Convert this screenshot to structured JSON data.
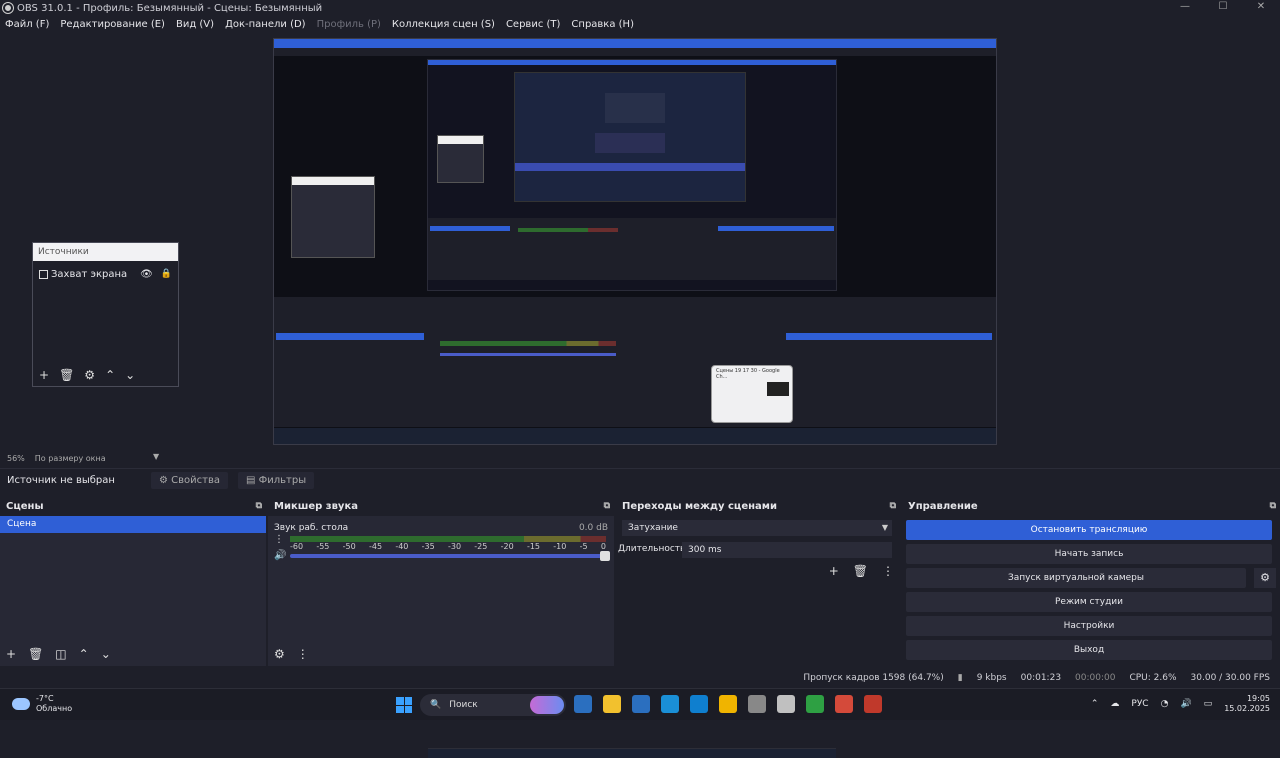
{
  "window": {
    "title": "OBS 31.0.1 - Профиль: Безымянный - Сцены: Безымянный",
    "controls": [
      "—",
      "☐",
      "✕"
    ]
  },
  "menu": [
    {
      "label": "Файл (F)",
      "disabled": false
    },
    {
      "label": "Редактирование (E)",
      "disabled": false
    },
    {
      "label": "Вид (V)",
      "disabled": false
    },
    {
      "label": "Док-панели (D)",
      "disabled": false
    },
    {
      "label": "Профиль (P)",
      "disabled": true
    },
    {
      "label": "Коллекция сцен (S)",
      "disabled": false
    },
    {
      "label": "Сервис (T)",
      "disabled": false
    },
    {
      "label": "Справка (H)",
      "disabled": false
    }
  ],
  "floating_sources": {
    "title": "Источники",
    "item": "Захват экрана"
  },
  "zoom": {
    "percent": "56%",
    "mode": "По размеру окна"
  },
  "context_bar": {
    "label": "Источник не выбран",
    "properties": "Свойства",
    "filters": "Фильтры"
  },
  "scenes": {
    "title": "Сцены",
    "items": [
      "Сцена"
    ]
  },
  "mixer": {
    "title": "Микшер звука",
    "track_name": "Звук раб. стола",
    "level": "0.0 dB",
    "ticks": [
      "-60",
      "-55",
      "-50",
      "-45",
      "-40",
      "-35",
      "-30",
      "-25",
      "-20",
      "-15",
      "-10",
      "-5",
      "0"
    ],
    "volume": 1.0
  },
  "transitions": {
    "title": "Переходы между сценами",
    "selected": "Затухание",
    "duration_label": "Длительность",
    "duration": "300 ms"
  },
  "controls": {
    "title": "Управление",
    "stop_stream": "Остановить трансляцию",
    "start_record": "Начать запись",
    "virtual_cam": "Запуск виртуальной камеры",
    "studio_mode": "Режим студии",
    "settings": "Настройки",
    "exit": "Выход"
  },
  "status": {
    "dropped": "Пропуск кадров 1598 (64.7%)",
    "bitrate": "9 kbps",
    "stream_time": "00:01:23",
    "record_time": "00:00:00",
    "cpu": "CPU: 2.6%",
    "fps": "30.00 / 30.00 FPS"
  },
  "taskbar": {
    "temp": "-7°C",
    "weather": "Облачно",
    "search": "Поиск",
    "lang": "РУС",
    "time": "19:05",
    "date": "15.02.2025",
    "app_colors": [
      "#2b6fbf",
      "#f2c12e",
      "#2b6fbf",
      "#1a8fd6",
      "#0f7fcf",
      "#f0b400",
      "#888",
      "#c0c0c0",
      "#2ea043",
      "#d44a3a",
      "#c0392b"
    ]
  },
  "thumbnail": {
    "title": "Сцены 19 17 30 - Google Ch..."
  }
}
